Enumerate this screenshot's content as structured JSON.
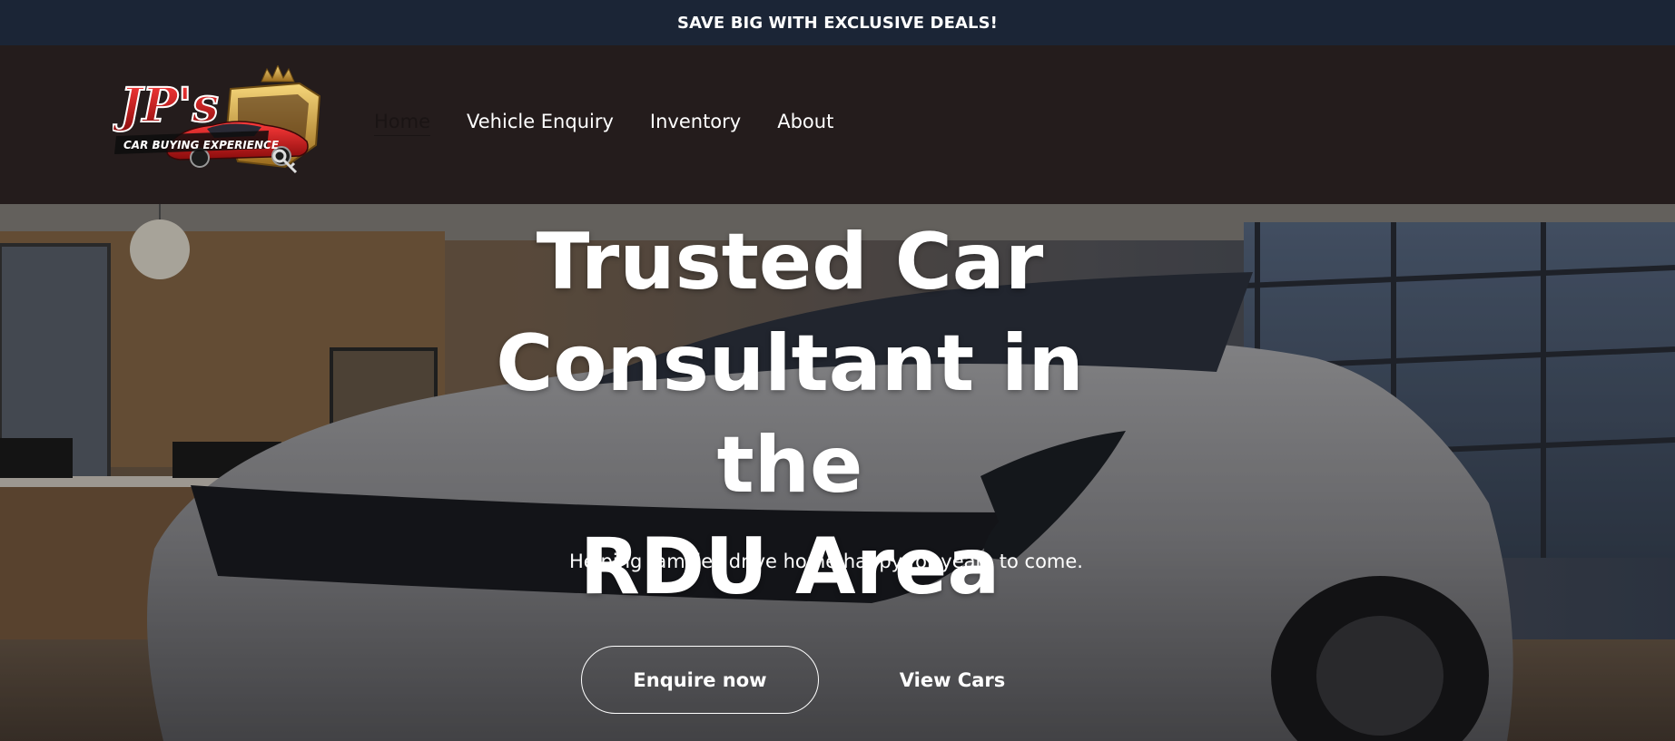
{
  "announcement": {
    "text": "SAVE BIG WITH EXCLUSIVE DEALS!"
  },
  "header": {
    "logo": {
      "brand_text": "JP's",
      "tagline": "CAR BUYING EXPERIENCE"
    },
    "nav": [
      {
        "label": "Home",
        "active": true
      },
      {
        "label": "Vehicle Enquiry",
        "active": false
      },
      {
        "label": "Inventory",
        "active": false
      },
      {
        "label": "About",
        "active": false
      }
    ]
  },
  "hero": {
    "title_line1": "Trusted Car",
    "title_line2": "Consultant in the",
    "title_line3": "RDU Area",
    "subtitle": "Helping families drive home happy for years to come.",
    "primary_button": "Enquire now",
    "secondary_button": "View Cars"
  },
  "colors": {
    "announcement_bg": "#1b2536",
    "header_bg": "#241c1c",
    "text": "#ffffff",
    "active_nav": "#1a1414"
  }
}
